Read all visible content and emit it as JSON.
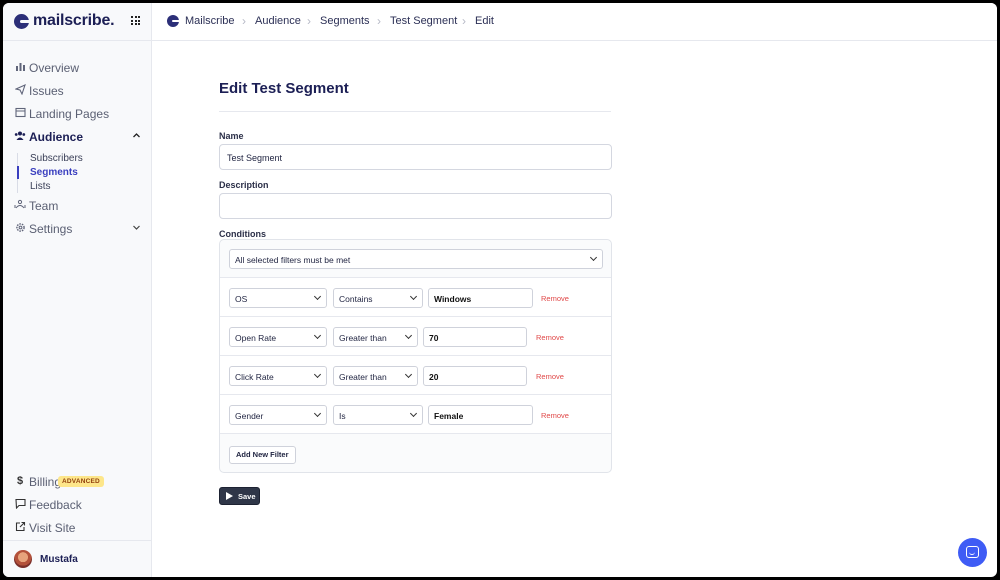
{
  "brand": {
    "name": "mailscribe."
  },
  "sidebar": {
    "items": [
      {
        "label": "Overview",
        "icon": "bar-chart-icon"
      },
      {
        "label": "Issues",
        "icon": "paper-plane-icon"
      },
      {
        "label": "Landing Pages",
        "icon": "layout-icon"
      },
      {
        "label": "Audience",
        "icon": "users-icon",
        "active": true
      },
      {
        "label": "Team",
        "icon": "team-icon"
      },
      {
        "label": "Settings",
        "icon": "gear-icon"
      }
    ],
    "audience_sub": [
      "Subscribers",
      "Segments",
      "Lists"
    ],
    "bottom": [
      {
        "label": "Billing",
        "icon": "dollar-icon",
        "badge": "ADVANCED"
      },
      {
        "label": "Feedback",
        "icon": "feedback-icon"
      },
      {
        "label": "Visit Site",
        "icon": "external-link-icon"
      }
    ],
    "user": "Mustafa"
  },
  "breadcrumbs": [
    "Mailscribe",
    "Audience",
    "Segments",
    "Test Segment",
    "Edit"
  ],
  "form": {
    "title": "Edit Test Segment",
    "name_label": "Name",
    "name_value": "Test Segment",
    "description_label": "Description",
    "description_value": "",
    "conditions_label": "Conditions",
    "match_mode": "All selected filters must be met",
    "filters": [
      {
        "field": "OS",
        "operator": "Contains",
        "value": "Windows"
      },
      {
        "field": "Open Rate",
        "operator": "Greater than",
        "value": "70"
      },
      {
        "field": "Click Rate",
        "operator": "Greater than",
        "value": "20"
      },
      {
        "field": "Gender",
        "operator": "Is",
        "value": "Female"
      }
    ],
    "remove_label": "Remove",
    "add_filter_label": "Add New Filter",
    "save_label": "Save"
  },
  "colors": {
    "accent": "#3a3fbf",
    "brand": "#1c1f55",
    "remove": "#e04848",
    "chat": "#3f5cf5"
  }
}
